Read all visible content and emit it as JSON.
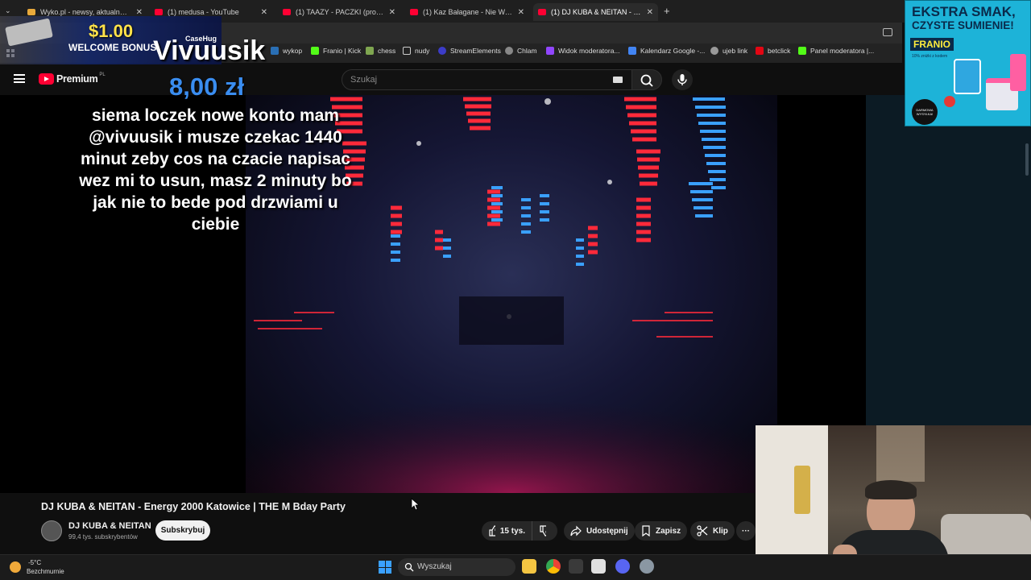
{
  "browser": {
    "tabs": [
      {
        "label": "Wyko.pl - newsy, aktualności",
        "active": false
      },
      {
        "label": "(1) medusa - YouTube",
        "active": false
      },
      {
        "label": "(1) TAAZY - PACZKI (prod. Crac",
        "active": false
      },
      {
        "label": "(1) Kaz Bałagane - Nie Wal Z Dy",
        "active": false
      },
      {
        "label": "(1) DJ KUBA & NEITAN - Energ",
        "active": true
      }
    ],
    "new_tab": "+",
    "bookmarks": [
      "wykop",
      "Franio | Kick",
      "chess",
      "nudy",
      "StreamElements",
      "Chlam",
      "Widok moderatora...",
      "Kalendarz Google -...",
      "ujeb link",
      "betclick",
      "Panel moderatora |..."
    ]
  },
  "youtube": {
    "logo": "Premium",
    "region": "PL",
    "search_placeholder": "Szukaj"
  },
  "video": {
    "title": "DJ KUBA & NEITAN - Energy 2000 Katowice | THE M Bday Party",
    "channel": "DJ KUBA & NEITAN",
    "subscribers": "99,4 tys. subskrybentów",
    "subscribe_label": "Subskrybuj",
    "likes": "15 tys.",
    "share_label": "Udostępnij",
    "save_label": "Zapisz",
    "clip_label": "Klip",
    "more_label": "···"
  },
  "donation": {
    "promo_amount": "$1.00",
    "promo_text": "WELCOME BONUS",
    "promo_brand": "CaseHug",
    "name": "Vivuusik",
    "amount": "8,00 zł",
    "message": "siema loczek nowe konto mam @vivuusik i musze czekac 1440 minut zeby cos na czacie napisac wez mi to usun, masz 2 minuty bo jak nie to bede pod drzwiami u ciebie"
  },
  "ad": {
    "headline_1": "EKSTRA SMAK,",
    "headline_2": "CZYSTE SUMIENIE!",
    "brand": "FRANIO",
    "sub": "10% zniżki z kodem",
    "badge": "DARMOWA WYSYŁKA!"
  },
  "taskbar": {
    "temperature": "-5°C",
    "weather": "Bezchmurnie",
    "search_placeholder": "Wyszukaj"
  },
  "colors": {
    "background": "#0f0f0f",
    "accent_red": "#ff0033",
    "donation_blue": "#3a8df0"
  }
}
